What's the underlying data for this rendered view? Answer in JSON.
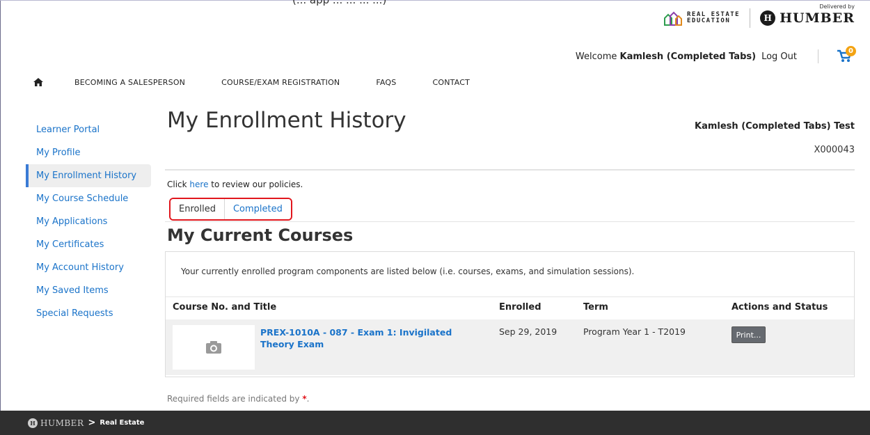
{
  "clipped_caption": "(... app ... ... ... ...)",
  "brand": {
    "real_estate_line1": "REAL ESTATE",
    "real_estate_line2": "EDUCATION",
    "delivered_by": "Delivered by",
    "humber": "HUMBER",
    "humber_mark": "H"
  },
  "welcome": {
    "prefix": "Welcome",
    "name": "Kamlesh (Completed Tabs)",
    "logout": "Log Out",
    "cart_count": "0"
  },
  "topnav": {
    "items": [
      "BECOMING A SALESPERSON",
      "COURSE/EXAM REGISTRATION",
      "FAQS",
      "CONTACT"
    ]
  },
  "sidebar": {
    "items": [
      {
        "label": "Learner Portal"
      },
      {
        "label": "My Profile"
      },
      {
        "label": "My Enrollment History"
      },
      {
        "label": "My Course Schedule"
      },
      {
        "label": "My Applications"
      },
      {
        "label": "My Certificates"
      },
      {
        "label": "My Account History"
      },
      {
        "label": "My Saved Items"
      },
      {
        "label": "Special Requests"
      }
    ]
  },
  "main": {
    "title": "My Enrollment History",
    "user_full_name": "Kamlesh (Completed Tabs) Test",
    "user_id": "X000043",
    "policy_prefix": "Click",
    "policy_link": "here",
    "policy_suffix": "to review our policies.",
    "tabs": [
      "Enrolled",
      "Completed"
    ],
    "section_title": "My Current Courses",
    "intro": "Your currently enrolled program components are listed below (i.e. courses, exams, and simulation sessions).",
    "columns": [
      "Course No. and Title",
      "Enrolled",
      "Term",
      "Actions and Status"
    ],
    "rows": [
      {
        "title": "PREX-1010A - 087 - Exam 1: Invigilated Theory Exam",
        "enrolled": "Sep 29, 2019",
        "term": "Program Year 1 - T2019",
        "action": "Print..."
      }
    ],
    "required_prefix": "Required fields are indicated by",
    "required_star": "*",
    "required_suffix": "."
  },
  "footer": {
    "brand": "HUMBER",
    "chevron": ">",
    "sub": "Real Estate"
  },
  "colors": {
    "link": "#1a73c9",
    "highlight": "#e1161d",
    "cart_badge": "#f3a313",
    "footer_bg": "#2f2f2f"
  }
}
